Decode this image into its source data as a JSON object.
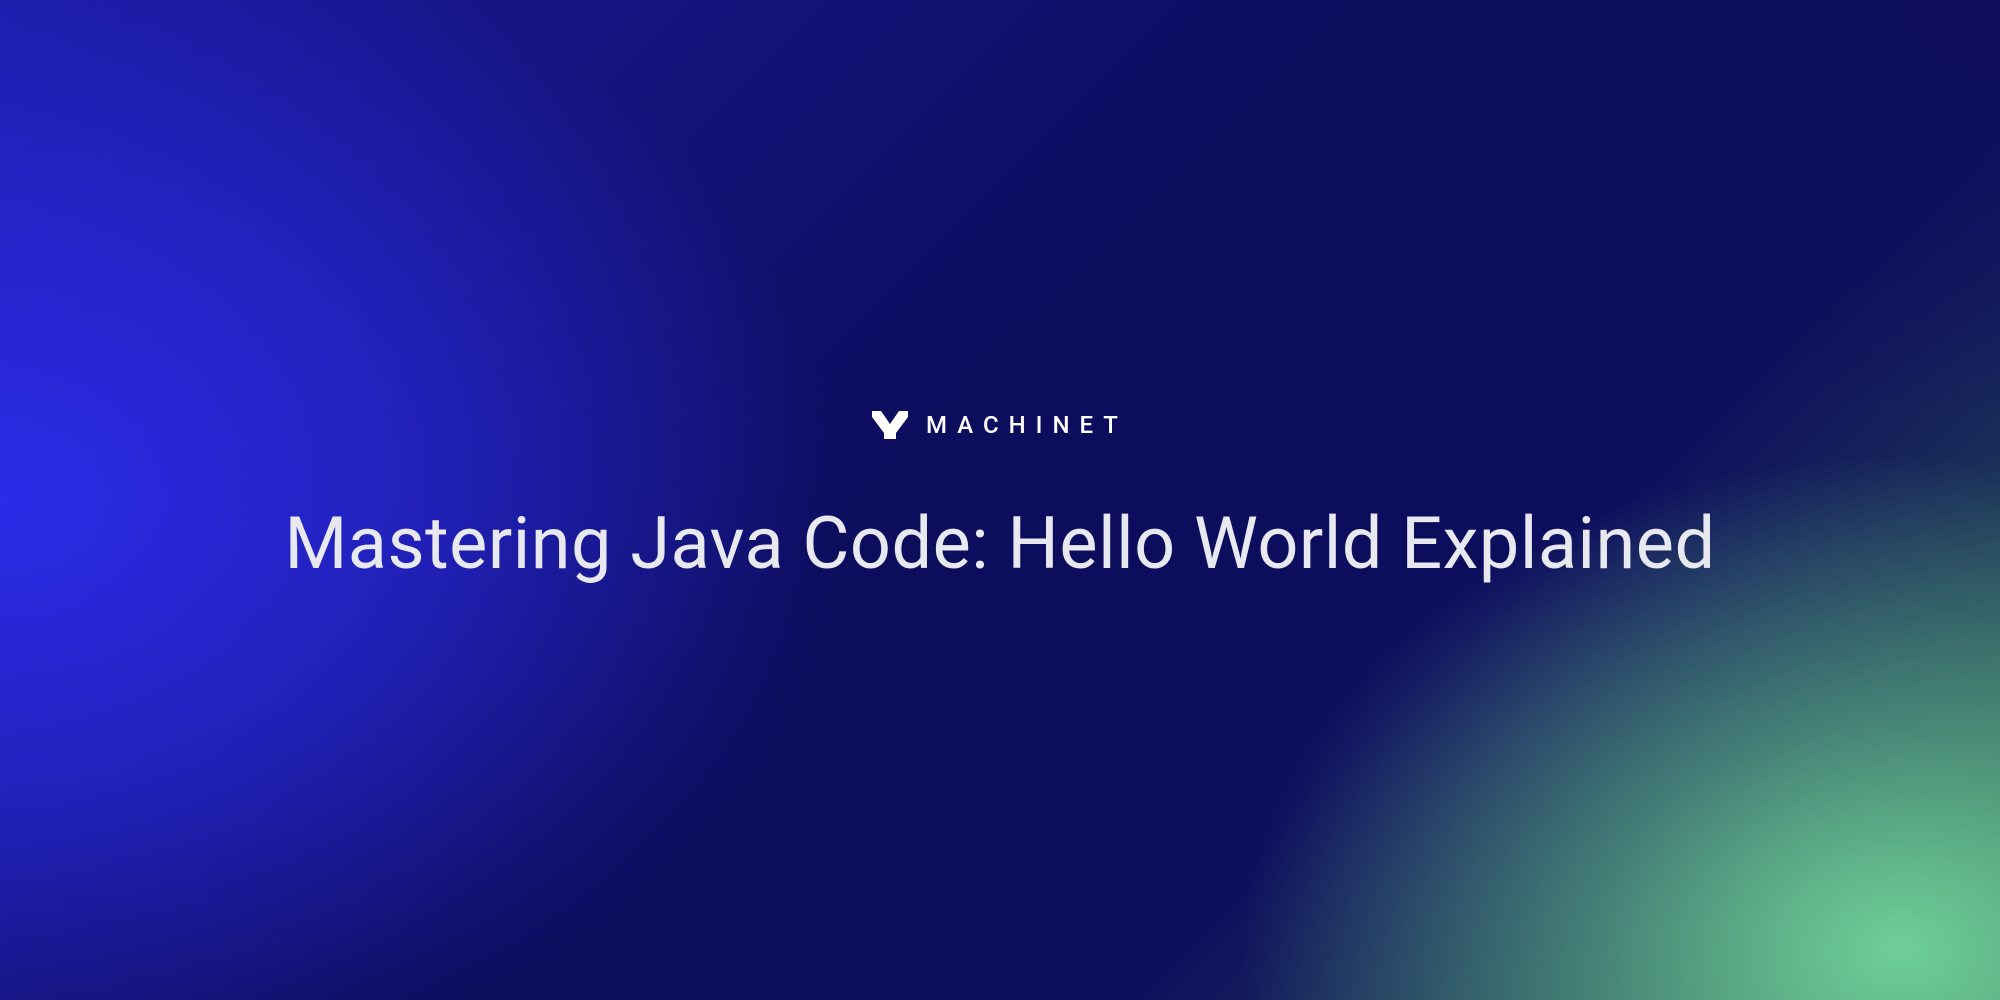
{
  "brand": {
    "name": "MACHINET",
    "icon": "machinet-m-icon"
  },
  "hero": {
    "title": "Mastering Java Code: Hello World Explained"
  },
  "colors": {
    "text": "#e8e8f0",
    "gradient_blue": "#2b2be8",
    "gradient_navy": "#0d0d5e",
    "gradient_green": "#6fcf97"
  }
}
